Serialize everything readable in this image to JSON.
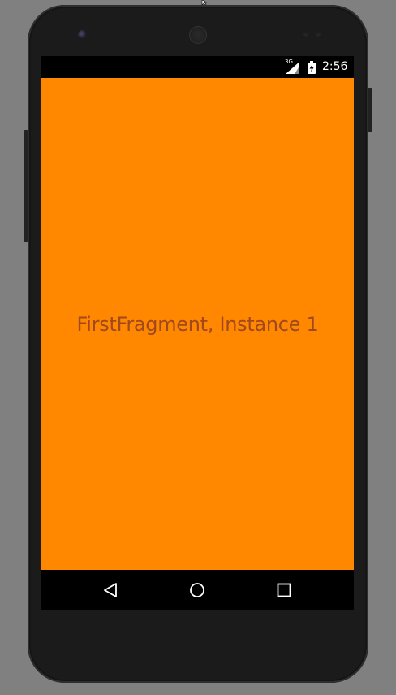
{
  "status_bar": {
    "network_type": "3G",
    "time": "2:56",
    "icons": [
      "signal-icon",
      "battery-charging-icon"
    ]
  },
  "fragment": {
    "label": "FirstFragment, Instance 1",
    "background_color": "#FF8800",
    "text_color": "#A0481E"
  },
  "nav_bar": {
    "buttons": [
      "back-icon",
      "home-icon",
      "recents-icon"
    ]
  }
}
